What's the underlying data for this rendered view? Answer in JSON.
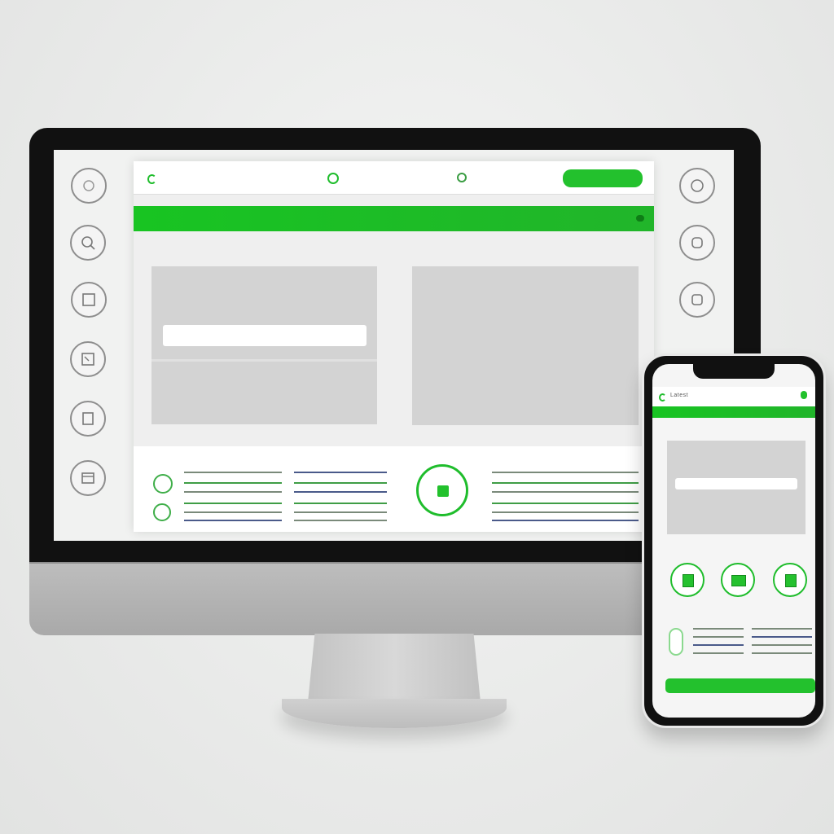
{
  "colors": {
    "accent": "#1fbd2c",
    "frame": "#111111",
    "screen_bg": "#f1f2f1",
    "card": "#d3d3d3"
  },
  "desktop": {
    "left_rail_icons": [
      "circle-icon",
      "search-icon",
      "document-icon",
      "image-icon",
      "file-icon",
      "folder-icon"
    ],
    "right_rail_icons": [
      "circle-icon",
      "chat-icon",
      "square-icon",
      "circle-icon"
    ],
    "app": {
      "header_text_left": "",
      "header_text_center": "",
      "header_button": ""
    }
  },
  "phone": {
    "header_title": "Latest",
    "header_mid": "",
    "header_right": "",
    "buttons": [
      "",
      ""
    ]
  }
}
